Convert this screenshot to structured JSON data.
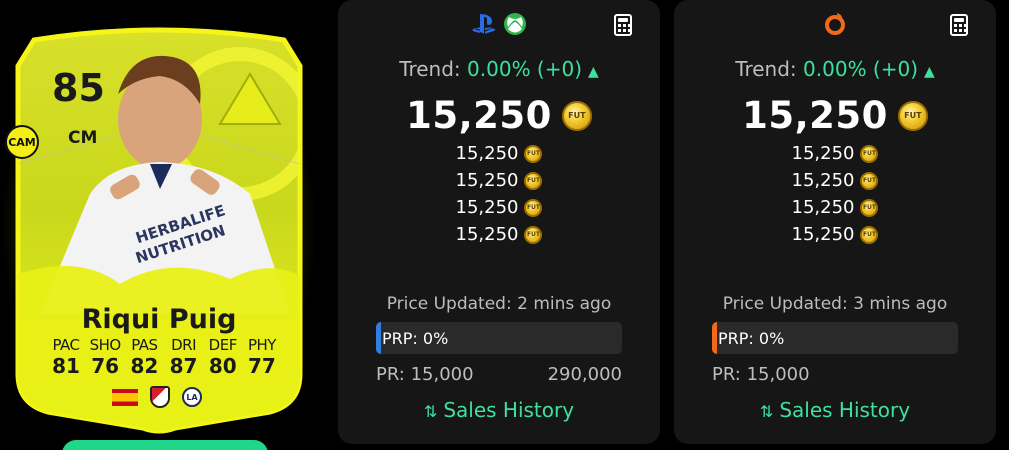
{
  "card": {
    "rating": "85",
    "position": "CM",
    "alt_position": "CAM",
    "name": "Riqui Puig",
    "stats": [
      {
        "label": "PAC",
        "value": "81"
      },
      {
        "label": "SHO",
        "value": "76"
      },
      {
        "label": "PAS",
        "value": "82"
      },
      {
        "label": "DRI",
        "value": "87"
      },
      {
        "label": "DEF",
        "value": "80"
      },
      {
        "label": "PHY",
        "value": "77"
      }
    ],
    "shirt_text": "HERBALIFE NUTRITION",
    "nation": "spain-flag",
    "league": "mls-badge",
    "club": "la-galaxy-badge",
    "accent_color": "#e8f016"
  },
  "console_panel": {
    "platforms": [
      "playstation-icon",
      "xbox-icon"
    ],
    "trend_label": "Trend:",
    "trend_value": "0.00% (+0)",
    "price": "15,250",
    "prices": [
      "15,250",
      "15,250",
      "15,250",
      "15,250"
    ],
    "updated": "Price Updated: 2 mins ago",
    "prp": "PRP: 0%",
    "prp_fraction": 0,
    "prp_color": "#2f7fe0",
    "pr_min": "PR: 15,000",
    "pr_max": "290,000",
    "sales_history": "Sales History"
  },
  "pc_panel": {
    "platforms": [
      "origin-icon"
    ],
    "trend_label": "Trend:",
    "trend_value": "0.00% (+0)",
    "price": "15,250",
    "prices": [
      "15,250",
      "15,250",
      "15,250",
      "15,250"
    ],
    "updated": "Price Updated: 3 mins ago",
    "prp": "PRP: 0%",
    "prp_fraction": 0,
    "prp_color": "#f06a1a",
    "pr_min": "PR: 15,000",
    "pr_max": "",
    "sales_history": "Sales History"
  },
  "coin_label": "FUT",
  "colors": {
    "trend_green": "#3ee0a0",
    "panel_bg": "#161616"
  }
}
